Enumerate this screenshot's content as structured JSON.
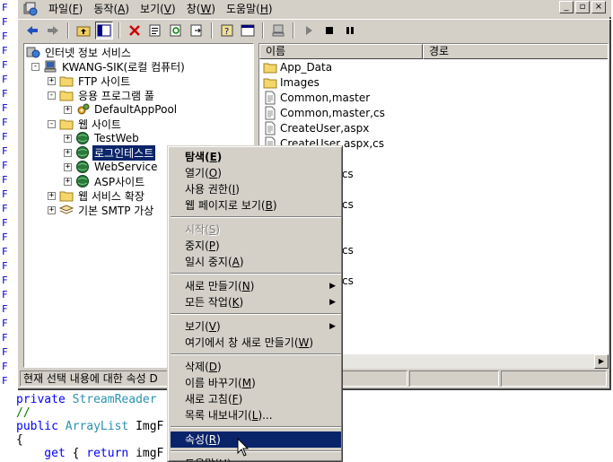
{
  "menubar": {
    "items": [
      {
        "label": "파일(F)"
      },
      {
        "label": "동작(A)"
      },
      {
        "label": "보기(V)"
      },
      {
        "label": "창(W)"
      },
      {
        "label": "도움말(H)"
      }
    ],
    "window_controls": [
      "_",
      "▫",
      "×"
    ]
  },
  "toolbar": {
    "buttons": [
      "back-icon",
      "forward-icon",
      "up-folder-icon",
      "show-tree-icon",
      "delete-icon",
      "properties-icon",
      "refresh-icon",
      "export-icon",
      "help-icon",
      "console-icon",
      "computer-icon",
      "play-icon",
      "stop-icon",
      "pause-icon"
    ]
  },
  "tree": {
    "nodes": [
      {
        "label": "인터넷 정보 서비스",
        "level": 0,
        "expander": "",
        "icon": "iis-icon"
      },
      {
        "label": "KWANG-SIK(로컬 컴퓨터)",
        "level": 1,
        "expander": "-",
        "icon": "computer-icon"
      },
      {
        "label": "FTP 사이트",
        "level": 2,
        "expander": "+",
        "icon": "folder-icon"
      },
      {
        "label": "응용 프로그램 풀",
        "level": 2,
        "expander": "-",
        "icon": "folder-icon"
      },
      {
        "label": "DefaultAppPool",
        "level": 3,
        "expander": "+",
        "icon": "gear-icon"
      },
      {
        "label": "웹 사이트",
        "level": 2,
        "expander": "-",
        "icon": "folder-icon"
      },
      {
        "label": "TestWeb",
        "level": 3,
        "expander": "+",
        "icon": "globe-icon"
      },
      {
        "label": "로그인테스트",
        "level": 3,
        "expander": "+",
        "icon": "globe-icon",
        "selected": true
      },
      {
        "label": "WebService",
        "level": 3,
        "expander": "+",
        "icon": "globe-icon"
      },
      {
        "label": "ASP사이트",
        "level": 3,
        "expander": "+",
        "icon": "globe-icon"
      },
      {
        "label": "웹 서비스 확장",
        "level": 2,
        "expander": "+",
        "icon": "folder-icon"
      },
      {
        "label": "기본 SMTP 가상",
        "level": 2,
        "expander": "+",
        "icon": "smtp-icon"
      }
    ]
  },
  "list": {
    "columns": [
      "이름",
      "경로"
    ],
    "items": [
      {
        "name": "App_Data",
        "icon": "folder-icon"
      },
      {
        "name": "Images",
        "icon": "folder-icon"
      },
      {
        "name": "Common,master",
        "icon": "file-icon"
      },
      {
        "name": "Common,master,cs",
        "icon": "file-icon"
      },
      {
        "name": "CreateUser,aspx",
        "icon": "file-icon"
      },
      {
        "name": "CreateUser,aspx,cs",
        "icon": "file-icon"
      },
      {
        "name": ",cs",
        "icon": "none"
      },
      {
        "name": "cs",
        "icon": "none"
      },
      {
        "name": "cs",
        "icon": "none"
      },
      {
        "name": "cs",
        "icon": "none"
      }
    ]
  },
  "statusbar": {
    "text": "현재 선택 내용에 대한 속성 D"
  },
  "context_menu": {
    "items": [
      {
        "label": "탐색(E)",
        "bold": true
      },
      {
        "label": "열기(O)"
      },
      {
        "label": "사용 권한(I)"
      },
      {
        "label": "웹 페이지로 보기(B)"
      },
      {
        "sep": true
      },
      {
        "label": "시작(S)",
        "disabled": true
      },
      {
        "label": "중지(P)"
      },
      {
        "label": "일시 중지(A)"
      },
      {
        "sep": true
      },
      {
        "label": "새로 만들기(N)",
        "submenu": true
      },
      {
        "label": "모든 작업(K)",
        "submenu": true
      },
      {
        "sep": true
      },
      {
        "label": "보기(V)",
        "submenu": true
      },
      {
        "label": "여기에서 창 새로 만들기(W)"
      },
      {
        "sep": true
      },
      {
        "label": "삭제(D)"
      },
      {
        "label": "이름 바꾸기(M)"
      },
      {
        "label": "새로 고침(F)"
      },
      {
        "label": "목록 내보내기(L)..."
      },
      {
        "sep": true
      },
      {
        "label": "속성(R)",
        "highlighted": true
      },
      {
        "sep": true
      },
      {
        "label": "도움말(H)"
      }
    ]
  },
  "code": {
    "lines": [
      {
        "parts": [
          {
            "t": "private ",
            "c": "kw"
          },
          {
            "t": "StreamReader",
            "c": "ty"
          }
        ]
      },
      {
        "parts": [
          {
            "t": "//",
            "c": "cm"
          }
        ]
      },
      {
        "parts": [
          {
            "t": "public ",
            "c": "kw"
          },
          {
            "t": "ArrayList",
            "c": "ty"
          },
          {
            "t": " ImgF",
            "c": ""
          }
        ]
      },
      {
        "parts": [
          {
            "t": "{",
            "c": ""
          }
        ]
      },
      {
        "parts": [
          {
            "t": "    get",
            "c": "kw"
          },
          {
            "t": " { ",
            "c": ""
          },
          {
            "t": "return",
            "c": "kw"
          },
          {
            "t": " imgF",
            "c": ""
          }
        ]
      }
    ],
    "gutter_text": "F"
  },
  "colors": {
    "face": "#d4d0c8",
    "highlight": "#0a246a",
    "keyword": "#0000ff",
    "type": "#2b91af",
    "comment": "#008000"
  }
}
